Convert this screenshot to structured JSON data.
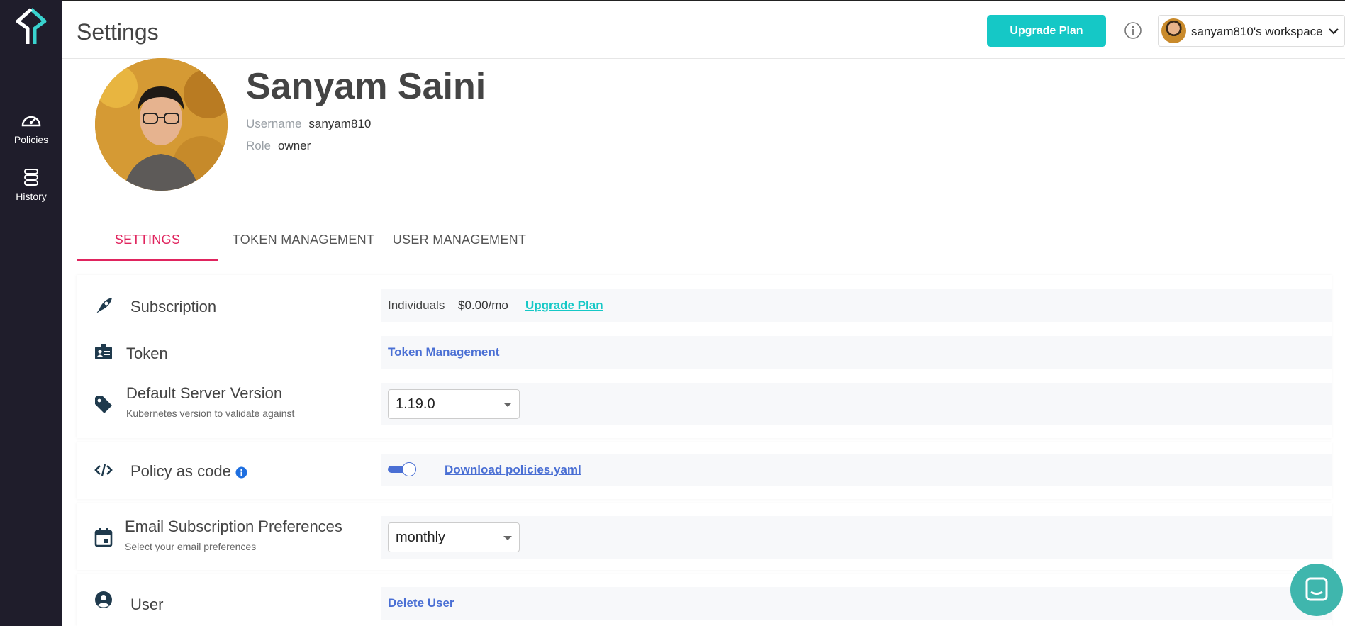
{
  "app": {
    "title": "Settings"
  },
  "sidebar": {
    "items": [
      {
        "label": "Policies",
        "icon": "speedometer-icon"
      },
      {
        "label": "History",
        "icon": "database-icon"
      }
    ]
  },
  "header": {
    "upgrade_label": "Upgrade Plan",
    "workspace_name": "sanyam810's workspace"
  },
  "profile": {
    "name": "Sanyam Saini",
    "username_label": "Username",
    "username": "sanyam810",
    "role_label": "Role",
    "role": "owner"
  },
  "tabs": [
    {
      "label": "SETTINGS",
      "active": true
    },
    {
      "label": "TOKEN MANAGEMENT",
      "active": false
    },
    {
      "label": "USER MANAGEMENT",
      "active": false
    }
  ],
  "settings": {
    "subscription": {
      "title": "Subscription",
      "plan": "Individuals",
      "price": "$0.00/mo",
      "upgrade_link": "Upgrade Plan"
    },
    "token": {
      "title": "Token",
      "link": "Token Management"
    },
    "server_version": {
      "title": "Default Server Version",
      "subtitle": "Kubernetes version to validate against",
      "selected": "1.19.0"
    },
    "policy_as_code": {
      "title": "Policy as code",
      "toggle_on": true,
      "link": "Download policies.yaml"
    },
    "email_prefs": {
      "title": "Email Subscription Preferences",
      "subtitle": "Select your email preferences",
      "selected": "monthly"
    },
    "user": {
      "title": "User",
      "link": "Delete User"
    }
  },
  "colors": {
    "sidebar_bg": "#1f1d2b",
    "accent_teal": "#15c8c6",
    "active_tab": "#e0245e",
    "link_blue": "#4a6fd4",
    "chat_bubble": "#3fb6ad"
  }
}
